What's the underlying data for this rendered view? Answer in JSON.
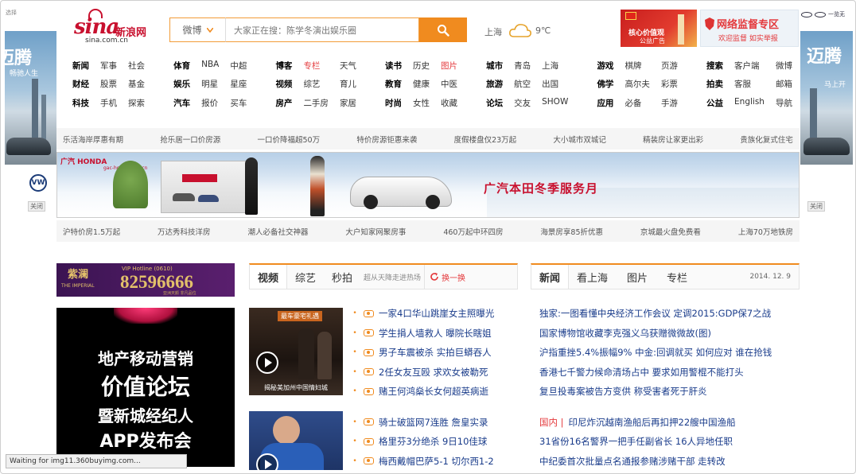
{
  "status_bar": {
    "text": "Waiting for img11.360buyimg.com..."
  },
  "top_left_tag": "选择",
  "top_right_tag": "一览无",
  "left_ad": {
    "title": "迈腾",
    "subtitle": "畅驰人生",
    "close": "关闭"
  },
  "right_ad": {
    "title": "迈腾",
    "subtitle": "马上开",
    "close": "关闭"
  },
  "logo": {
    "main": "sina",
    "cn": "新浪网",
    "url": "sina.com.cn"
  },
  "search": {
    "channel": "微博",
    "placeholder": "大家正在搜：陈学冬演出娱乐圈"
  },
  "weather": {
    "city": "上海",
    "temp": "9℃"
  },
  "promo_left": {
    "line1": "核心价值观",
    "line2": "公益广告"
  },
  "promo_right": {
    "line1": "网络监督专区",
    "line2": "欢迎监督 如实举报"
  },
  "nav_groups": [
    {
      "rows": [
        [
          "新闻",
          "军事",
          "社会"
        ],
        [
          "财经",
          "股票",
          "基金"
        ],
        [
          "科技",
          "手机",
          "探索"
        ]
      ]
    },
    {
      "rows": [
        [
          "体育",
          "NBA",
          "中超"
        ],
        [
          "娱乐",
          "明星",
          "星座"
        ],
        [
          "汽车",
          "报价",
          "买车"
        ]
      ]
    },
    {
      "rows": [
        [
          "博客",
          "专栏",
          "天气"
        ],
        [
          "视频",
          "综艺",
          "育儿"
        ],
        [
          "房产",
          "二手房",
          "家居"
        ]
      ]
    },
    {
      "rows": [
        [
          "读书",
          "历史",
          "图片"
        ],
        [
          "教育",
          "健康",
          "中医"
        ],
        [
          "时尚",
          "女性",
          "收藏"
        ]
      ]
    },
    {
      "rows": [
        [
          "城市",
          "青岛",
          "上海"
        ],
        [
          "旅游",
          "航空",
          "出国"
        ],
        [
          "论坛",
          "交友",
          "SHOW"
        ]
      ]
    },
    {
      "rows": [
        [
          "游戏",
          "棋牌",
          "页游"
        ],
        [
          "佛学",
          "高尔夫",
          "彩票"
        ],
        [
          "应用",
          "必备",
          "手游"
        ]
      ]
    },
    {
      "rows": [
        [
          "搜索",
          "客户端",
          "微博"
        ],
        [
          "拍卖",
          "客服",
          "邮箱"
        ],
        [
          "公益",
          "English",
          "导航"
        ]
      ]
    }
  ],
  "strip_top": [
    "乐活海岸厚惠有期",
    "抢乐居一口价房源",
    "一口价降福超50万",
    "特价房源钜惠来袭",
    "度假楼盘仅23万起",
    "大小城市双城记",
    "精装房让家更出彩",
    "贵族化复式住宅"
  ],
  "banner": {
    "brand": "广汽 HONDA",
    "brand_site": "gac-honda.com.cn",
    "headline": "广汽本田冬季服务月"
  },
  "strip_bottom": [
    "沪特价房1.5万起",
    "万达秀科技洋房",
    "潮人必备社交神器",
    "大户知家网聚房事",
    "460万起中环四房",
    "海景房享85折优惠",
    "京城最火盘免费看",
    "上海70万地铁房"
  ],
  "ad_imperial": {
    "name": "紫澜",
    "name_en": "THE IMPERIAL",
    "hotline_label": "VIP Hotline (0610)",
    "phone": "82596666",
    "foot": "亚洲天颜 非凡品位"
  },
  "ad_forum": {
    "lines": [
      "地产移动营销",
      "价值论坛",
      "暨新城经纪人",
      "APP发布会"
    ]
  },
  "video_tabs": {
    "tabs": [
      "视频",
      "综艺",
      "秒拍"
    ],
    "promo": "超从天降走进热场",
    "refresh": "换一换"
  },
  "video_thumb1": {
    "caption_top": "最车豪宅礼遇",
    "caption_bottom": "揭秘美加州中国情妇城"
  },
  "video_list": [
    "一家4口华山跳崖女主照曝光",
    "学生捐人墙救人 曝院长瞎姐",
    "男子车震被杀 实拍巨蟒吞人",
    "2任女友互殴 求欢女被勒死",
    "赌王何鸿燊长女何超英病逝",
    "骑士破篮网7连胜 詹皇实录",
    "格里芬3分绝杀 9日10佳球",
    "梅西戴帽巴萨5-1 切尔西1-2"
  ],
  "news_tabs": {
    "tabs": [
      "新闻",
      "看上海",
      "图片",
      "专栏"
    ],
    "date": "2014. 12. 9"
  },
  "news_list": [
    {
      "cat": "",
      "text": "独家:一图看懂中央经济工作会议 定调2015:GDP保7之战"
    },
    {
      "cat": "",
      "text": "国家博物馆收藏李克强义乌获赠微微故(图)"
    },
    {
      "cat": "",
      "text": "沪指重挫5.4%振幅9% 中金:回调就买 如何应对 谁在抢钱"
    },
    {
      "cat": "",
      "text": "香港七千警力候命清场占中 要求如用警棍不能打头"
    },
    {
      "cat": "",
      "text": "复旦投毒案被告方变供 称受害者死于肝炎"
    },
    {
      "cat": "国内 |",
      "text": "印尼炸沉越南渔船后再扣押22艘中国渔船"
    },
    {
      "cat": "",
      "text": "31省份16名警界一把手任副省长 16人异地任职"
    },
    {
      "cat": "",
      "text": "中纪委首次批量点名通报参赌涉赌干部 走转改"
    }
  ]
}
